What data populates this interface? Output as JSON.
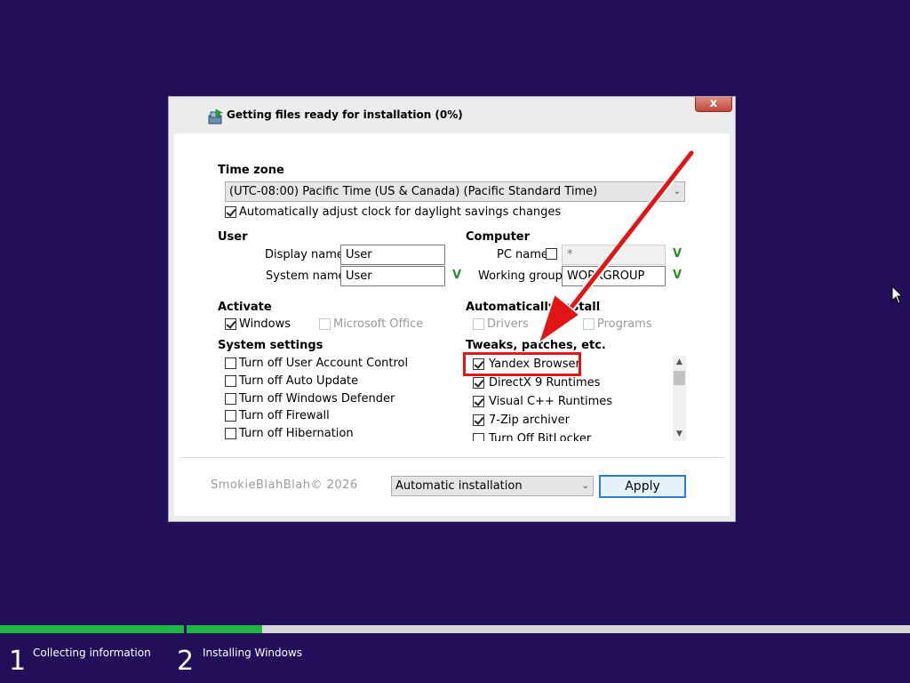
{
  "dialog": {
    "title": "Getting files ready for installation (0%)",
    "close_label": "x"
  },
  "timezone": {
    "header": "Time zone",
    "selected": "(UTC-08:00) Pacific Time (US & Canada) (Pacific Standard Time)",
    "daylight_label": "Automatically adjust clock for daylight savings changes",
    "daylight_checked": true
  },
  "user": {
    "header": "User",
    "display_name_label": "Display name",
    "display_name_value": "User",
    "system_name_label": "System name",
    "system_name_value": "User",
    "valid_mark": "V"
  },
  "computer": {
    "header": "Computer",
    "pc_name_label": "PC name",
    "pc_name_value": "*",
    "working_group_label": "Working group",
    "working_group_value": "WORKGROUP",
    "valid_mark": "V"
  },
  "activate": {
    "header": "Activate",
    "windows_label": "Windows",
    "office_label": "Microsoft Office"
  },
  "auto_install": {
    "header": "Automatically install",
    "drivers_label": "Drivers",
    "programs_label": "Programs"
  },
  "system_settings": {
    "header": "System settings",
    "items": [
      "Turn off User Account Control",
      "Turn off Auto Update",
      "Turn off Windows Defender",
      "Turn off Firewall",
      "Turn off Hibernation"
    ]
  },
  "tweaks": {
    "header": "Tweaks, patches, etc.",
    "items": [
      "Yandex Browser",
      "DirectX 9 Runtimes",
      "Visual C++ Runtimes",
      "7-Zip archiver",
      "Turn Off BitLocker"
    ]
  },
  "footer": {
    "copyright": "SmokieBlahBlah© 2026",
    "mode_selected": "Automatic installation",
    "apply_label": "Apply"
  },
  "setup_steps": [
    {
      "number": "1",
      "label": "Collecting information"
    },
    {
      "number": "2",
      "label": "Installing Windows"
    }
  ],
  "colors": {
    "background": "#230e5a",
    "progress": "#1fb543",
    "highlight": "#e01616",
    "valid": "#2c8a2c"
  }
}
